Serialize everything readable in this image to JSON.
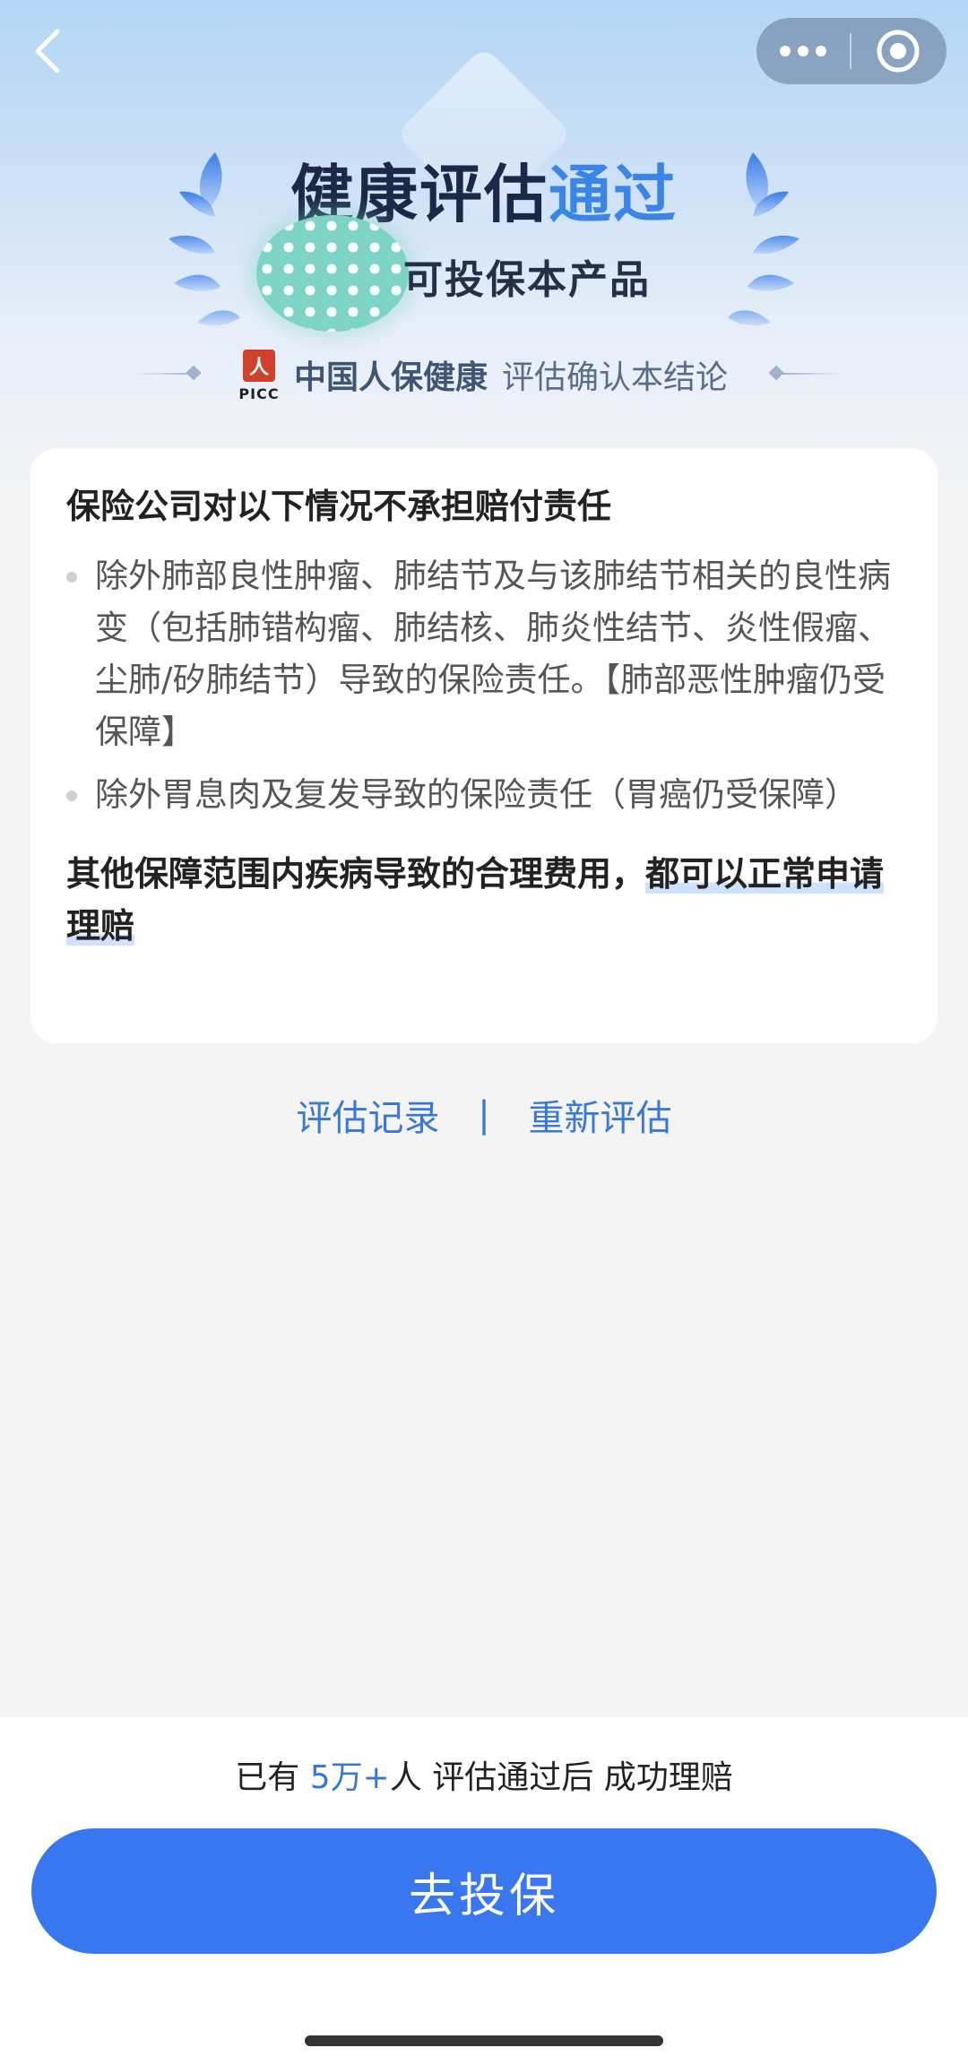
{
  "nav": {
    "back_icon": "chevron-left-icon",
    "more_icon": "ellipsis-icon",
    "close_icon": "target-circle-icon"
  },
  "hero": {
    "title_part1": "健康评估",
    "title_part2": "通过",
    "subtitle": "可投保本产品",
    "brand_logo_text": "PICC",
    "brand_seal_glyph": "人",
    "brand_name": "中国人保健康",
    "brand_caption": "评估确认本结论"
  },
  "card": {
    "title": "保险公司对以下情况不承担赔付责任",
    "exclusions": [
      "除外肺部良性肿瘤、肺结节及与该肺结节相关的良性病变（包括肺错构瘤、肺结核、肺炎性结节、炎性假瘤、尘肺/矽肺结节）导致的保险责任。【肺部恶性肿瘤仍受保障】",
      "除外胃息肉及复发导致的保险责任（胃癌仍受保障）"
    ],
    "note_plain": "其他保障范围内疾病导致的合理费用，",
    "note_highlight": "都可以正常申请理赔"
  },
  "links": {
    "records": "评估记录",
    "separator": "|",
    "reassess": "重新评估"
  },
  "footer": {
    "stat_prefix": "已有",
    "stat_number": "5万+",
    "stat_suffix": "人 评估通过后 成功理赔",
    "apply_label": "去投保"
  },
  "colors": {
    "accent": "#3877ef",
    "link": "#3b78d6",
    "title_blue": "#3a86e8",
    "title_dark": "#1b2847",
    "background": "#f4f4f5"
  }
}
